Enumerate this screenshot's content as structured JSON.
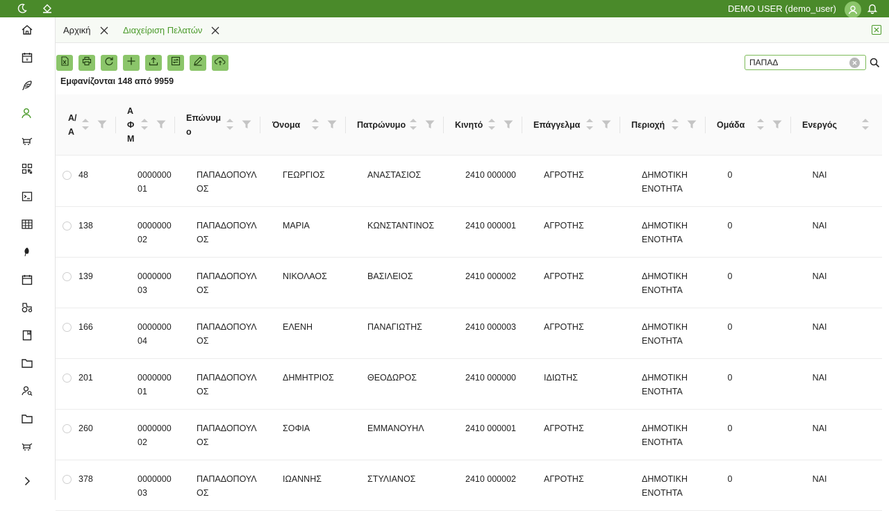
{
  "topbar": {
    "user_name": "DEMO USER (demo_user)",
    "icons": [
      "moon-icon",
      "paint-bucket-icon",
      "user-avatar-icon",
      "bell-icon"
    ]
  },
  "sidebar": {
    "icons": [
      "home-icon",
      "calendar-money-icon",
      "feather-icon",
      "user-icon",
      "cow-icon",
      "qr-code-icon",
      "terminal-icon",
      "grid-icon",
      "leaf-icon",
      "calendar-icon",
      "tractor-icon",
      "book-icon",
      "folder-icon",
      "user-search-icon",
      "folder-icon",
      "cow-icon",
      "chevron-right-icon"
    ]
  },
  "tabs": [
    {
      "label": "Αρχική"
    },
    {
      "label": "Διαχείριση Πελατών"
    }
  ],
  "toolbar": {
    "buttons": [
      "export-excel",
      "print",
      "refresh",
      "add",
      "upload",
      "transfer",
      "edit",
      "cloud-upload"
    ]
  },
  "count_text": "Εμφανίζονται 148 από 9959",
  "search": {
    "value": "ΠΑΠΑΔ"
  },
  "table": {
    "columns": [
      {
        "key": "aa",
        "label": "Α/\nΑ"
      },
      {
        "key": "afm",
        "label": "Α\nΦ\nΜ"
      },
      {
        "key": "eponymo",
        "label": "Επώνυμ\nο"
      },
      {
        "key": "onoma",
        "label": "Όνομα"
      },
      {
        "key": "patronymo",
        "label": "Πατρώνυμο"
      },
      {
        "key": "kinito",
        "label": "Κινητό"
      },
      {
        "key": "epaggelma",
        "label": "Επάγγελμα"
      },
      {
        "key": "perioxi",
        "label": "Περιοχή"
      },
      {
        "key": "omada",
        "label": "Ομάδα"
      },
      {
        "key": "energos",
        "label": "Ενεργός"
      }
    ],
    "rows": [
      {
        "aa": "48",
        "afm": "0000000\n01",
        "eponymo": "ΠΑΠΑΔΟΠΟΥΛ\nΟΣ",
        "onoma": "ΓΕΩΡΓΙΟΣ",
        "patronymo": "ΑΝΑΣΤΑΣΙΟΣ",
        "kinito": "2410 000000",
        "epaggelma": "ΑΓΡΟΤΗΣ",
        "perioxi": "ΔΗΜΟΤΙΚΗ\nΕΝΟΤΗΤΑ",
        "omada": "0",
        "energos": "ΝΑΙ"
      },
      {
        "aa": "138",
        "afm": "0000000\n02",
        "eponymo": "ΠΑΠΑΔΟΠΟΥΛ\nΟΣ",
        "onoma": "ΜΑΡΙΑ",
        "patronymo": "ΚΩΝΣΤΑΝΤΙΝΟΣ",
        "kinito": "2410 000001",
        "epaggelma": "ΑΓΡΟΤΗΣ",
        "perioxi": "ΔΗΜΟΤΙΚΗ\nΕΝΟΤΗΤΑ",
        "omada": "0",
        "energos": "ΝΑΙ"
      },
      {
        "aa": "139",
        "afm": "0000000\n03",
        "eponymo": "ΠΑΠΑΔΟΠΟΥΛ\nΟΣ",
        "onoma": "ΝΙΚΟΛΑΟΣ",
        "patronymo": "ΒΑΣΙΛΕΙΟΣ",
        "kinito": "2410 000002",
        "epaggelma": "ΑΓΡΟΤΗΣ",
        "perioxi": "ΔΗΜΟΤΙΚΗ\nΕΝΟΤΗΤΑ",
        "omada": "0",
        "energos": "ΝΑΙ"
      },
      {
        "aa": "166",
        "afm": "0000000\n04",
        "eponymo": "ΠΑΠΑΔΟΠΟΥΛ\nΟΣ",
        "onoma": "ΕΛΕΝΗ",
        "patronymo": "ΠΑΝΑΓΙΩΤΗΣ",
        "kinito": "2410 000003",
        "epaggelma": "ΑΓΡΟΤΗΣ",
        "perioxi": "ΔΗΜΟΤΙΚΗ\nΕΝΟΤΗΤΑ",
        "omada": "0",
        "energos": "ΝΑΙ"
      },
      {
        "aa": "201",
        "afm": "0000000\n01",
        "eponymo": "ΠΑΠΑΔΟΠΟΥΛ\nΟΣ",
        "onoma": "ΔΗΜΗΤΡΙΟΣ",
        "patronymo": "ΘΕΟΔΩΡΟΣ",
        "kinito": "2410 000000",
        "epaggelma": "ΙΔΙΩΤΗΣ",
        "perioxi": "ΔΗΜΟΤΙΚΗ\nΕΝΟΤΗΤΑ",
        "omada": "0",
        "energos": "ΝΑΙ"
      },
      {
        "aa": "260",
        "afm": "0000000\n02",
        "eponymo": "ΠΑΠΑΔΟΠΟΥΛ\nΟΣ",
        "onoma": "ΣΟΦΙΑ",
        "patronymo": "ΕΜΜΑΝΟΥΗΛ",
        "kinito": "2410 000001",
        "epaggelma": "ΑΓΡΟΤΗΣ",
        "perioxi": "ΔΗΜΟΤΙΚΗ\nΕΝΟΤΗΤΑ",
        "omada": "0",
        "energos": "ΝΑΙ"
      },
      {
        "aa": "378",
        "afm": "0000000\n03",
        "eponymo": "ΠΑΠΑΔΟΠΟΥΛ\nΟΣ",
        "onoma": "ΙΩΑΝΝΗΣ",
        "patronymo": "ΣΤΥΛΙΑΝΟΣ",
        "kinito": "2410 000002",
        "epaggelma": "ΑΓΡΟΤΗΣ",
        "perioxi": "ΔΗΜΟΤΙΚΗ\nΕΝΟΤΗΤΑ",
        "omada": "0",
        "energos": "ΝΑΙ"
      }
    ]
  },
  "colors": {
    "topbar": "#4a8a2a",
    "accent": "#4a9a2a",
    "button": "#8bc56a"
  }
}
